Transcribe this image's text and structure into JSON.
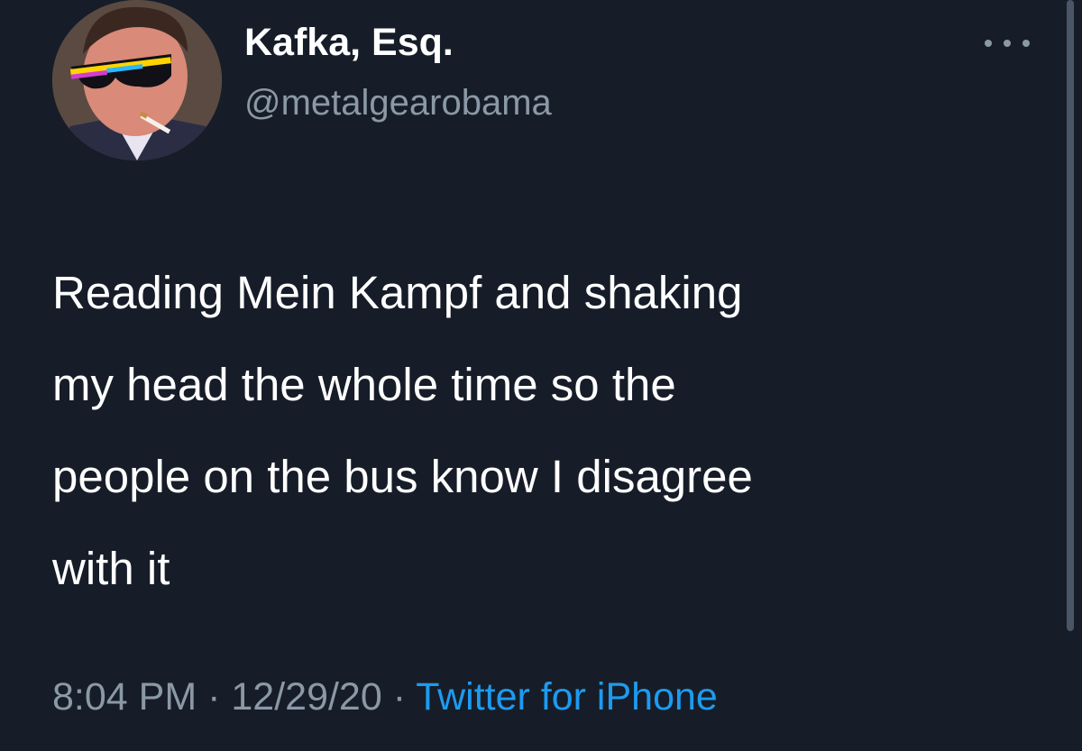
{
  "tweet": {
    "author": {
      "display_name": "Kafka, Esq.",
      "handle": "@metalgearobama"
    },
    "text": "Reading Mein Kampf and shaking\nmy head the whole time so the\npeople on the bus know I disagree\nwith it",
    "time": "8:04 PM",
    "separator": "·",
    "date": "12/29/20",
    "source": "Twitter for iPhone"
  },
  "icons": {
    "more": "more-options-icon"
  },
  "colors": {
    "background": "#161d28",
    "text_primary": "#ffffff",
    "text_secondary": "#8b98a5",
    "link": "#1d9bf0"
  }
}
